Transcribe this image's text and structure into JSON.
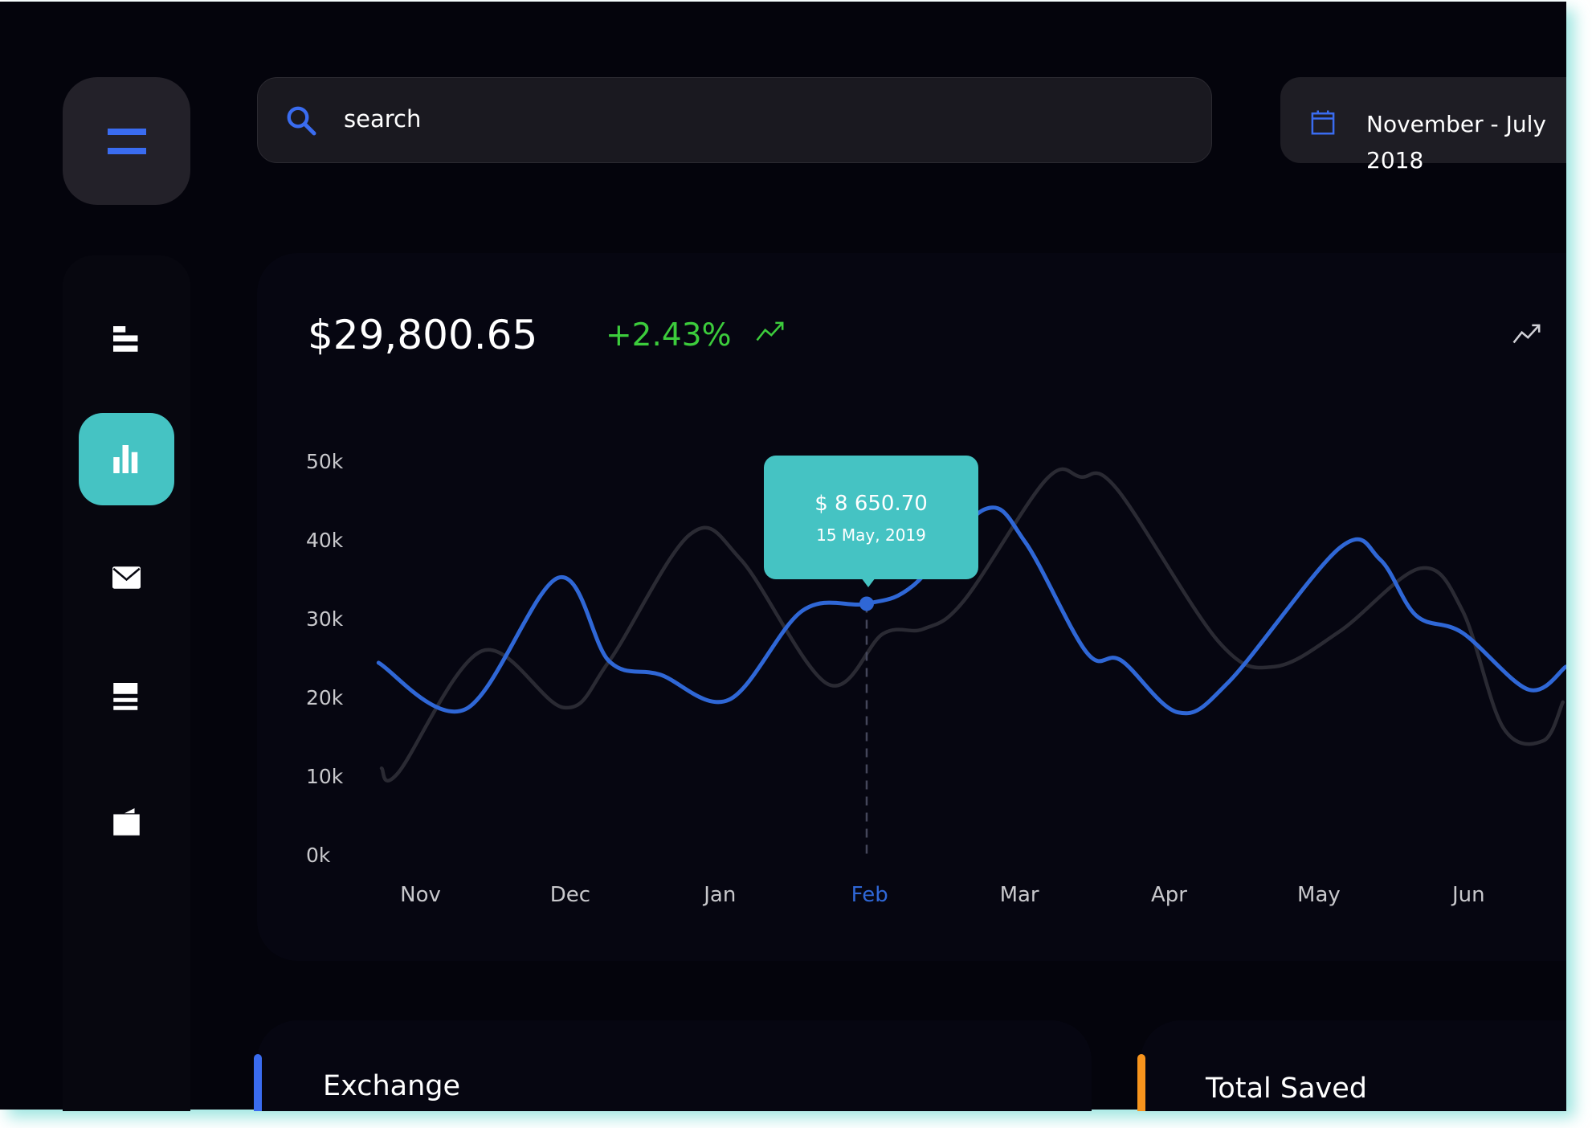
{
  "search": {
    "placeholder": "search",
    "icon": "search-icon"
  },
  "date_range": {
    "label": "November - July 2018",
    "icon": "calendar-icon"
  },
  "sidebar": {
    "items": [
      {
        "icon": "align-left-icon",
        "active": false
      },
      {
        "icon": "bar-chart-icon",
        "active": true
      },
      {
        "icon": "mail-icon",
        "active": false
      },
      {
        "icon": "list-icon",
        "active": false
      },
      {
        "icon": "wallet-icon",
        "active": false
      }
    ]
  },
  "summary": {
    "amount": "$29,800.65",
    "change": "+2.43%"
  },
  "tooltip": {
    "value": "$ 8 650.70",
    "date": "15 May, 2019"
  },
  "colors": {
    "accent": "#45c3c3",
    "blue": "#2f67d6",
    "green": "#3ccc3c",
    "orange": "#f7941d",
    "gray_series": "#2a2a33"
  },
  "chart_data": {
    "type": "line",
    "categories": [
      "Nov",
      "Dec",
      "Jan",
      "Feb",
      "Mar",
      "Apr",
      "May",
      "Jun"
    ],
    "highlighted_category": "Feb",
    "y_ticks": [
      "50k",
      "40k",
      "30k",
      "20k",
      "10k",
      "0k"
    ],
    "ylim": [
      0,
      50000
    ],
    "x_unit": "category index (Nov = 0)",
    "grid": false,
    "series": [
      {
        "color": "#2f67d6",
        "points": [
          [
            -0.28,
            24700
          ],
          [
            0.3,
            18800
          ],
          [
            0.92,
            35500
          ],
          [
            1.26,
            24900
          ],
          [
            1.6,
            23200
          ],
          [
            2.06,
            20000
          ],
          [
            2.55,
            31300
          ],
          [
            2.98,
            32200
          ],
          [
            3.29,
            34500
          ],
          [
            3.77,
            44200
          ],
          [
            4.04,
            40000
          ],
          [
            4.45,
            26000
          ],
          [
            4.68,
            25000
          ],
          [
            5.06,
            18400
          ],
          [
            5.4,
            22300
          ],
          [
            6.14,
            39300
          ],
          [
            6.41,
            37800
          ],
          [
            6.65,
            30700
          ],
          [
            6.96,
            28500
          ],
          [
            7.4,
            21300
          ],
          [
            7.65,
            24200
          ]
        ]
      },
      {
        "color": "#2a2a33",
        "points": [
          [
            -0.26,
            11300
          ],
          [
            -0.15,
            10700
          ],
          [
            0.41,
            26200
          ],
          [
            0.96,
            19000
          ],
          [
            1.26,
            24900
          ],
          [
            1.8,
            41000
          ],
          [
            2.14,
            37800
          ],
          [
            2.72,
            22000
          ],
          [
            3.09,
            28400
          ],
          [
            3.36,
            29000
          ],
          [
            3.63,
            32600
          ],
          [
            4.18,
            48000
          ],
          [
            4.41,
            48300
          ],
          [
            4.65,
            46800
          ],
          [
            5.33,
            27400
          ],
          [
            5.7,
            24200
          ],
          [
            6.14,
            28700
          ],
          [
            6.68,
            36700
          ],
          [
            6.96,
            31300
          ],
          [
            7.23,
            16500
          ],
          [
            7.5,
            14800
          ],
          [
            7.63,
            19700
          ]
        ]
      }
    ],
    "marker": {
      "x": 2.98,
      "y": 32200
    }
  },
  "cards": [
    {
      "title": "Exchange",
      "bar_color": "#3a6cf0"
    },
    {
      "title": "Total Saved",
      "bar_color": "#f7941d"
    }
  ]
}
